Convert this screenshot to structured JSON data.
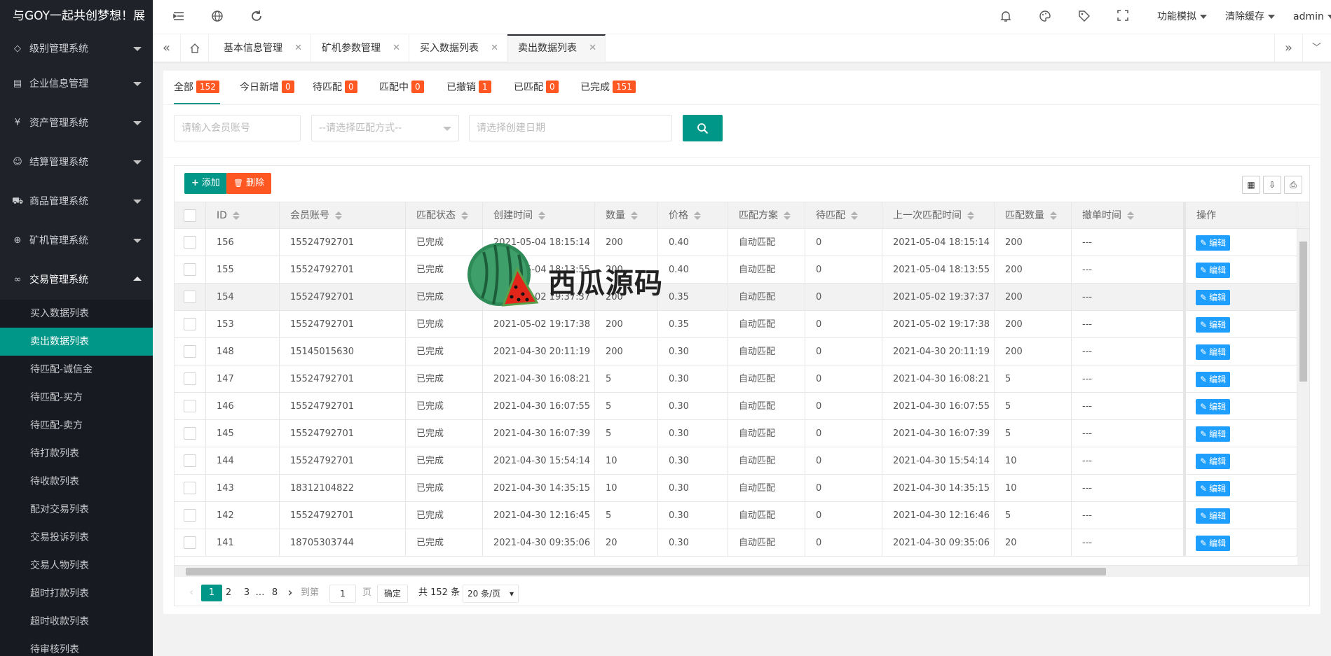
{
  "app": {
    "title": "与GOY一起共创梦想！展"
  },
  "sidebar": {
    "menus": [
      {
        "label": "级别管理系统",
        "icon": "diamond-icon"
      },
      {
        "label": "企业信息管理",
        "icon": "document-icon"
      },
      {
        "label": "资产管理系统",
        "icon": "yen-icon"
      },
      {
        "label": "结算管理系统",
        "icon": "smile-icon"
      },
      {
        "label": "商品管理系统",
        "icon": "cart-icon"
      },
      {
        "label": "矿机管理系统",
        "icon": "globe-icon"
      },
      {
        "label": "交易管理系统",
        "icon": "link-icon"
      }
    ],
    "submenu": [
      "买入数据列表",
      "卖出数据列表",
      "待匹配-诚信金",
      "待匹配-买方",
      "待匹配-卖方",
      "待打款列表",
      "待收款列表",
      "配对交易列表",
      "交易投诉列表",
      "交易人物列表",
      "超时打款列表",
      "超时收款列表",
      "待审核列表"
    ],
    "active_sub": "卖出数据列表"
  },
  "header": {
    "function_mode": "功能模拟",
    "clear_cache": "清除缓存",
    "user": "admin"
  },
  "tabs": [
    {
      "label": "基本信息管理"
    },
    {
      "label": "矿机参数管理"
    },
    {
      "label": "买入数据列表"
    },
    {
      "label": "卖出数据列表"
    }
  ],
  "subtabs": [
    {
      "label": "全部",
      "count": "152"
    },
    {
      "label": "今日新增",
      "count": "0"
    },
    {
      "label": "待匹配",
      "count": "0"
    },
    {
      "label": "匹配中",
      "count": "0"
    },
    {
      "label": "已撤销",
      "count": "1"
    },
    {
      "label": "已匹配",
      "count": "0"
    },
    {
      "label": "已完成",
      "count": "151"
    }
  ],
  "search": {
    "account_placeholder": "请输入会员账号",
    "match_select": "--请选择匹配方式--",
    "date_placeholder": "请选择创建日期"
  },
  "toolbar": {
    "add_label": "添加",
    "delete_label": "删除"
  },
  "table": {
    "columns": [
      "ID",
      "会员账号",
      "匹配状态",
      "创建时间",
      "数量",
      "价格",
      "匹配方案",
      "待匹配",
      "上一次匹配时间",
      "匹配数量",
      "撤单时间",
      "操作"
    ],
    "edit_label": "编辑",
    "rows": [
      [
        "156",
        "15524792701",
        "已完成",
        "2021-05-04 18:15:14",
        "200",
        "0.40",
        "自动匹配",
        "0",
        "2021-05-04 18:15:14",
        "200",
        "---"
      ],
      [
        "155",
        "15524792701",
        "已完成",
        "2021-05-04 18:13:55",
        "200",
        "0.40",
        "自动匹配",
        "0",
        "2021-05-04 18:13:55",
        "200",
        "---"
      ],
      [
        "154",
        "15524792701",
        "已完成",
        "2021-05-02 19:37:37",
        "200",
        "0.35",
        "自动匹配",
        "0",
        "2021-05-02 19:37:37",
        "200",
        "---"
      ],
      [
        "153",
        "15524792701",
        "已完成",
        "2021-05-02 19:17:38",
        "200",
        "0.35",
        "自动匹配",
        "0",
        "2021-05-02 19:17:38",
        "200",
        "---"
      ],
      [
        "148",
        "15145015630",
        "已完成",
        "2021-04-30 20:11:19",
        "200",
        "0.30",
        "自动匹配",
        "0",
        "2021-04-30 20:11:19",
        "200",
        "---"
      ],
      [
        "147",
        "15524792701",
        "已完成",
        "2021-04-30 16:08:21",
        "5",
        "0.30",
        "自动匹配",
        "0",
        "2021-04-30 16:08:21",
        "5",
        "---"
      ],
      [
        "146",
        "15524792701",
        "已完成",
        "2021-04-30 16:07:55",
        "5",
        "0.30",
        "自动匹配",
        "0",
        "2021-04-30 16:07:55",
        "5",
        "---"
      ],
      [
        "145",
        "15524792701",
        "已完成",
        "2021-04-30 16:07:39",
        "5",
        "0.30",
        "自动匹配",
        "0",
        "2021-04-30 16:07:39",
        "5",
        "---"
      ],
      [
        "144",
        "15524792701",
        "已完成",
        "2021-04-30 15:54:14",
        "10",
        "0.30",
        "自动匹配",
        "0",
        "2021-04-30 15:54:14",
        "10",
        "---"
      ],
      [
        "143",
        "18312104822",
        "已完成",
        "2021-04-30 14:35:15",
        "10",
        "0.30",
        "自动匹配",
        "0",
        "2021-04-30 14:35:15",
        "10",
        "---"
      ],
      [
        "142",
        "15524792701",
        "已完成",
        "2021-04-30 12:16:45",
        "5",
        "0.30",
        "自动匹配",
        "0",
        "2021-04-30 12:16:46",
        "5",
        "---"
      ],
      [
        "141",
        "18705303744",
        "已完成",
        "2021-04-30 09:35:06",
        "20",
        "0.30",
        "自动匹配",
        "0",
        "2021-04-30 09:35:06",
        "20",
        "---"
      ]
    ]
  },
  "pager": {
    "pages": [
      "2",
      "3",
      "8"
    ],
    "current": "1",
    "ellipsis": "…",
    "goto_label": "到第",
    "page_input": "1",
    "page_unit": "页",
    "confirm": "确定",
    "total": "共 152 条",
    "page_size": "20 条/页"
  },
  "watermark": {
    "text": "西瓜源码"
  },
  "colors": {
    "accent": "#009688",
    "badge": "#ff5722",
    "edit": "#1e9fff",
    "danger": "#ff5722",
    "sidebar": "#20222a"
  }
}
